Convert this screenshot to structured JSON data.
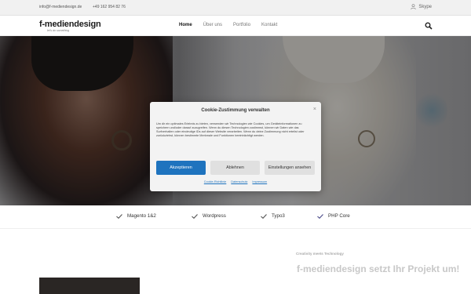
{
  "topbar": {
    "email": "info@f-mediendesign.de",
    "phone": "+49 162 954 82 76",
    "skype": "Skype"
  },
  "header": {
    "logo": "f-mediendesign",
    "logo_tagline": "let's do something",
    "nav": [
      "Home",
      "Über uns",
      "Portfolio",
      "Kontakt"
    ]
  },
  "modal": {
    "title": "Cookie-Zustimmung verwalten",
    "close": "×",
    "text": "Um dir ein optimales Erlebnis zu bieten, verwenden wir Technologien wie Cookies, um Geräteinformationen zu speichern und/oder darauf zuzugreifen. Wenn du diesen Technologien zustimmst, können wir Daten wie das Surfverhalten oder eindeutige IDs auf dieser Website verarbeiten. Wenn du deine Zustimmung nicht erteilst oder zurückziehst, können bestimmte Merkmale und Funktionen beeinträchtigt werden.",
    "accept": "Akzeptieren",
    "deny": "Ablehnen",
    "settings": "Einstellungen ansehen",
    "links": [
      "Cookie-Richtlinie",
      "Datenschutz",
      "Impressum"
    ]
  },
  "features": [
    "Magento 1&2",
    "Wordpress",
    "Typo3",
    "PHP Core"
  ],
  "lower": {
    "kicker": "Creativity meets Technology",
    "title": "f-mediendesign setzt Ihr Projekt um!"
  },
  "colors": {
    "accent": "#1e73be",
    "check": "#4a4a6a"
  }
}
